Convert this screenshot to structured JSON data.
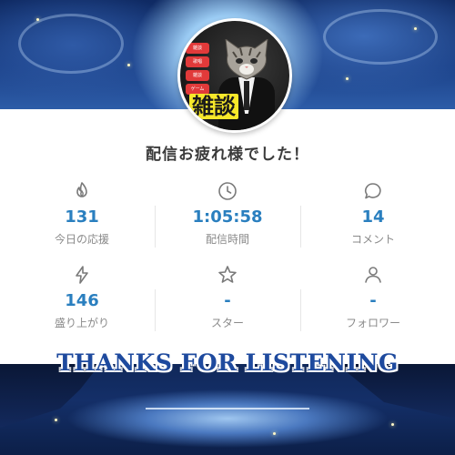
{
  "avatar": {
    "tags": [
      "雑談",
      "歌唱",
      "雑談",
      "ゲーム"
    ],
    "badge_label": "雑談"
  },
  "title": "配信お疲れ様でした！",
  "stats": [
    [
      {
        "icon": "flame-icon",
        "value": "131",
        "label": "今日の応援"
      },
      {
        "icon": "clock-icon",
        "value": "1:05:58",
        "label": "配信時間"
      },
      {
        "icon": "comment-icon",
        "value": "14",
        "label": "コメント"
      }
    ],
    [
      {
        "icon": "lightning-icon",
        "value": "146",
        "label": "盛り上がり"
      },
      {
        "icon": "star-icon",
        "value": "-",
        "label": "スター"
      },
      {
        "icon": "person-icon",
        "value": "-",
        "label": "フォロワー"
      }
    ]
  ],
  "banner_text": "THANKS FOR LISTENING",
  "colors": {
    "value_blue": "#2a7fbf",
    "label_gray": "#8a8a8a",
    "icon_gray": "#7a7a7a",
    "banner_blue": "#1e4a9e"
  }
}
